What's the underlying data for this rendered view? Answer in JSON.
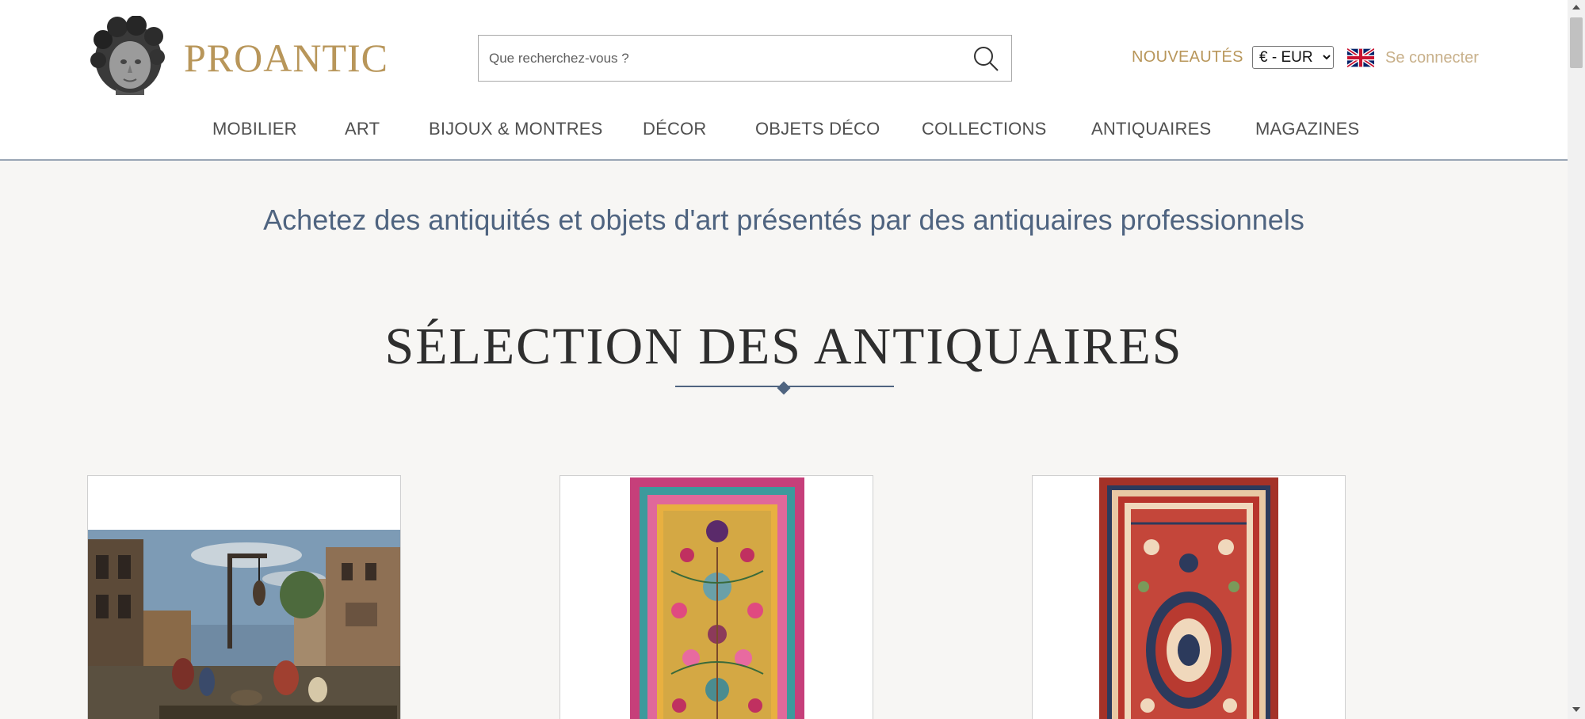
{
  "header": {
    "logo_text": "PROANTIC",
    "search": {
      "placeholder": "Que recherchez-vous ?",
      "value": ""
    },
    "nouveautes_label": "NOUVEAUTÉS",
    "currency": {
      "selected": "€ - EUR",
      "options": [
        "€ - EUR"
      ]
    },
    "language_flag": "uk-flag-icon",
    "login_label": "Se connecter"
  },
  "nav": {
    "items": [
      {
        "label": "MOBILIER"
      },
      {
        "label": "ART"
      },
      {
        "label": "BIJOUX & MONTRES"
      },
      {
        "label": "DÉCOR"
      },
      {
        "label": "OBJETS DÉCO"
      },
      {
        "label": "COLLECTIONS"
      },
      {
        "label": "ANTIQUAIRES"
      },
      {
        "label": "MAGAZINES"
      }
    ]
  },
  "main": {
    "tagline": "Achetez des antiquités et objets d'art présentés par des antiquaires professionnels",
    "section_title": "SÉLECTION DES ANTIQUAIRES",
    "cards": [
      {
        "image": "painting-street-scene"
      },
      {
        "image": "persian-rug-colorful"
      },
      {
        "image": "persian-rug-red"
      }
    ]
  },
  "colors": {
    "brand_gold": "#b8965a",
    "accent_blue": "#4f6480",
    "background": "#f7f6f4"
  }
}
